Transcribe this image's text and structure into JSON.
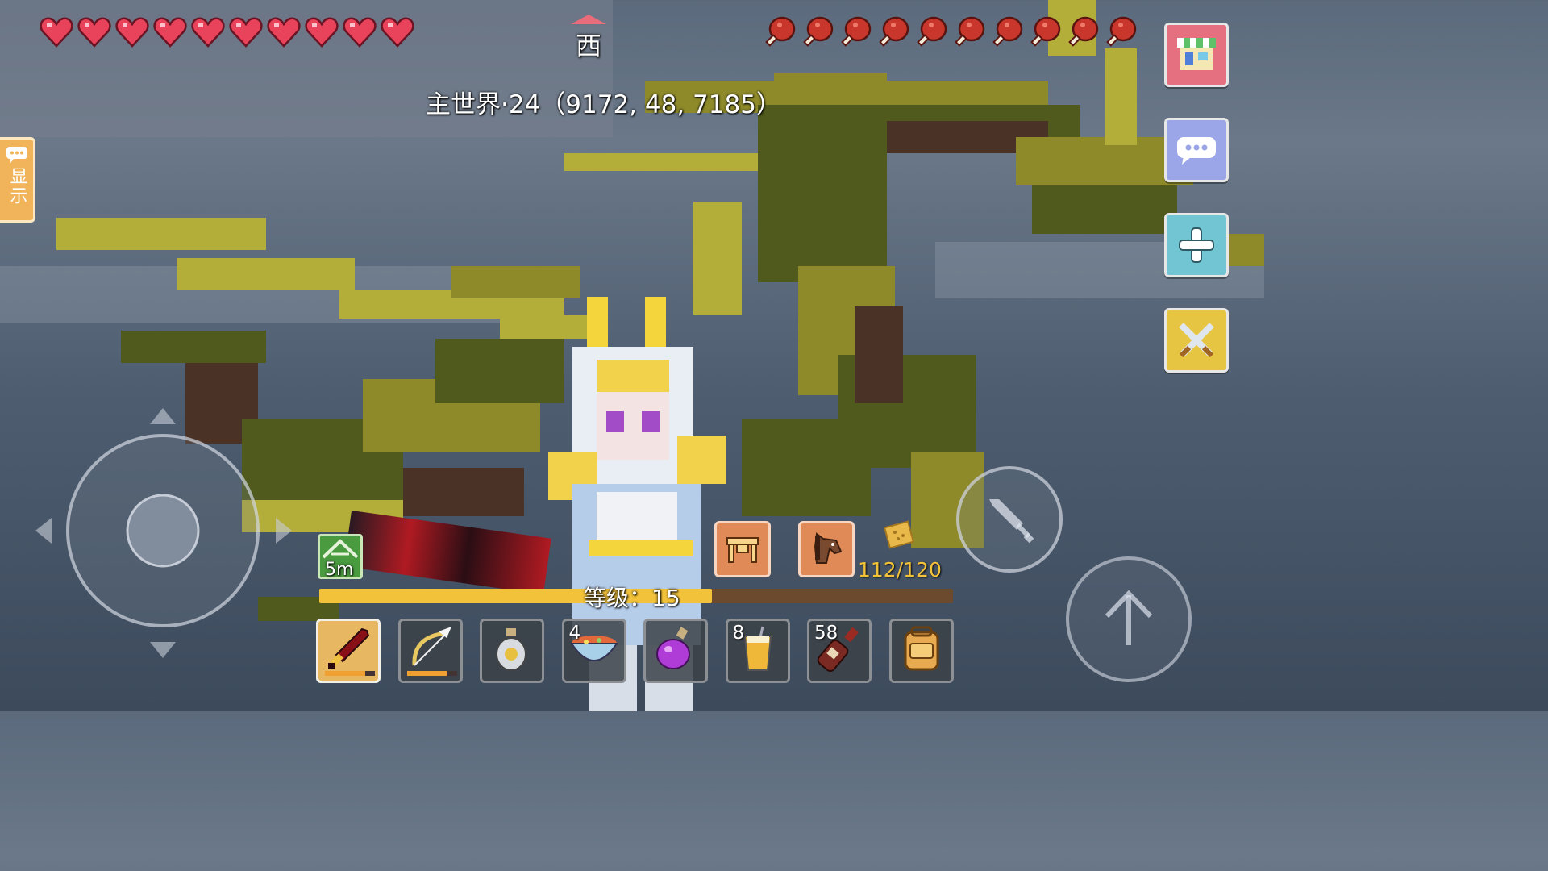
{
  "status": {
    "hearts": 10,
    "hunger": 10,
    "health_color": "#e8435a",
    "hunger_color": "#c9372c"
  },
  "compass": {
    "direction": "西"
  },
  "location": {
    "text": "主世界·24（9172, 48, 7185）"
  },
  "left_tab": {
    "label": "显示",
    "icon": "chat-bubble-icon"
  },
  "right_menu": [
    {
      "name": "shop",
      "icon": "shop-icon",
      "bg": "#e47080"
    },
    {
      "name": "chat",
      "icon": "chat-icon",
      "bg": "#9aa6e8"
    },
    {
      "name": "add",
      "icon": "plus-icon",
      "bg": "#72c6d4"
    },
    {
      "name": "pvp",
      "icon": "crossed-swords-icon",
      "bg": "#e5c542"
    }
  ],
  "mount": {
    "distance": "5m",
    "icon": "hang-glider-icon"
  },
  "quick_actions": [
    {
      "name": "craft-table",
      "icon": "crafting-table-icon"
    },
    {
      "name": "horse",
      "icon": "horse-icon"
    }
  ],
  "food": {
    "icon": "biscuit-icon",
    "value": "112/120"
  },
  "level": {
    "text": "等级：15",
    "progress": 0.62,
    "bar_color": "#f2c23a"
  },
  "hotbar": [
    {
      "name": "red-sword",
      "icon": "sword-icon",
      "count": "",
      "selected": true,
      "durability": 0.8
    },
    {
      "name": "winged-bow",
      "icon": "bow-icon",
      "count": "",
      "selected": false,
      "durability": 0.8
    },
    {
      "name": "potion-bottle",
      "icon": "bottle-icon",
      "count": "",
      "selected": false
    },
    {
      "name": "stew-bowl",
      "icon": "bowl-icon",
      "count": "4",
      "selected": false
    },
    {
      "name": "purple-potion",
      "icon": "potion-icon",
      "count": "",
      "selected": false
    },
    {
      "name": "juice-drink",
      "icon": "cup-icon",
      "count": "8",
      "selected": false
    },
    {
      "name": "wine-bottle",
      "icon": "wine-icon",
      "count": "58",
      "selected": false
    },
    {
      "name": "backpack",
      "icon": "backpack-icon",
      "count": "",
      "selected": false
    }
  ],
  "controls": {
    "joystick": "joystick-icon",
    "attack": "sword-icon",
    "jump": "arrow-up-icon"
  }
}
